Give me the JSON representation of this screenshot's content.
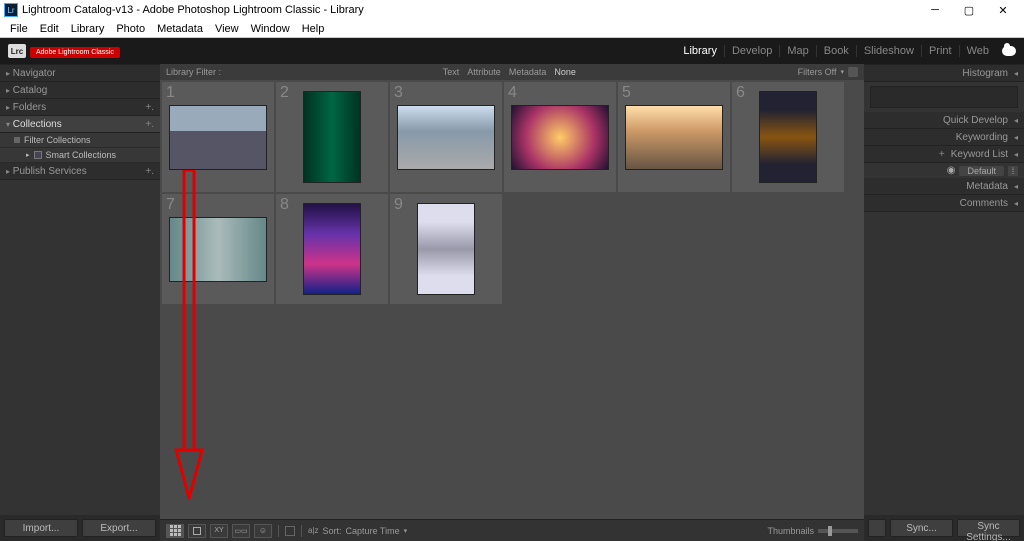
{
  "titlebar": {
    "title": "Lightroom Catalog-v13 - Adobe Photoshop Lightroom Classic - Library",
    "icon_label": "Lr"
  },
  "menubar": [
    "File",
    "Edit",
    "Library",
    "Photo",
    "Metadata",
    "View",
    "Window",
    "Help"
  ],
  "header": {
    "brand_icon": "Lrc",
    "brand_tag": "Adobe Lightroom Classic",
    "modules": [
      "Library",
      "Develop",
      "Map",
      "Book",
      "Slideshow",
      "Print",
      "Web"
    ],
    "active_module": "Library"
  },
  "left_panel": {
    "sections": [
      {
        "label": "Navigator",
        "extras": ""
      },
      {
        "label": "Catalog"
      },
      {
        "label": "Folders",
        "plus": true
      },
      {
        "label": "Collections",
        "plus": true,
        "expanded": true,
        "children": [
          {
            "label": "Filter Collections",
            "bullet": true
          },
          {
            "label": "Smart Collections",
            "indent": true
          }
        ]
      },
      {
        "label": "Publish Services",
        "plus": true
      }
    ],
    "buttons": {
      "import": "Import...",
      "export": "Export..."
    }
  },
  "right_panel": {
    "sections": [
      "Histogram",
      "Quick Develop",
      "Keywording",
      "Keyword List",
      "Metadata",
      "Comments"
    ],
    "metadata_preset": "Default",
    "buttons": {
      "sync": "Sync...",
      "sync_settings": "Sync Settings..."
    }
  },
  "filterbar": {
    "title": "Library Filter :",
    "options": [
      "Text",
      "Attribute",
      "Metadata",
      "None"
    ],
    "selected": "None",
    "filters_off": "Filters Off"
  },
  "grid": {
    "cells": [
      {
        "n": "1",
        "orient": "land",
        "cls": "t1"
      },
      {
        "n": "2",
        "orient": "port",
        "cls": "t2"
      },
      {
        "n": "3",
        "orient": "land",
        "cls": "t3"
      },
      {
        "n": "4",
        "orient": "land",
        "cls": "t4"
      },
      {
        "n": "5",
        "orient": "land",
        "cls": "t5"
      },
      {
        "n": "6",
        "orient": "port",
        "cls": "t6"
      },
      {
        "n": "7",
        "orient": "land",
        "cls": "t7"
      },
      {
        "n": "8",
        "orient": "port",
        "cls": "t8"
      },
      {
        "n": "9",
        "orient": "port",
        "cls": "t9"
      }
    ]
  },
  "toolbar": {
    "sort_label": "Sort:",
    "sort_value": "Capture Time",
    "thumbnails_label": "Thumbnails"
  },
  "annotation": {
    "type": "arrow-down",
    "color": "#e00000"
  }
}
